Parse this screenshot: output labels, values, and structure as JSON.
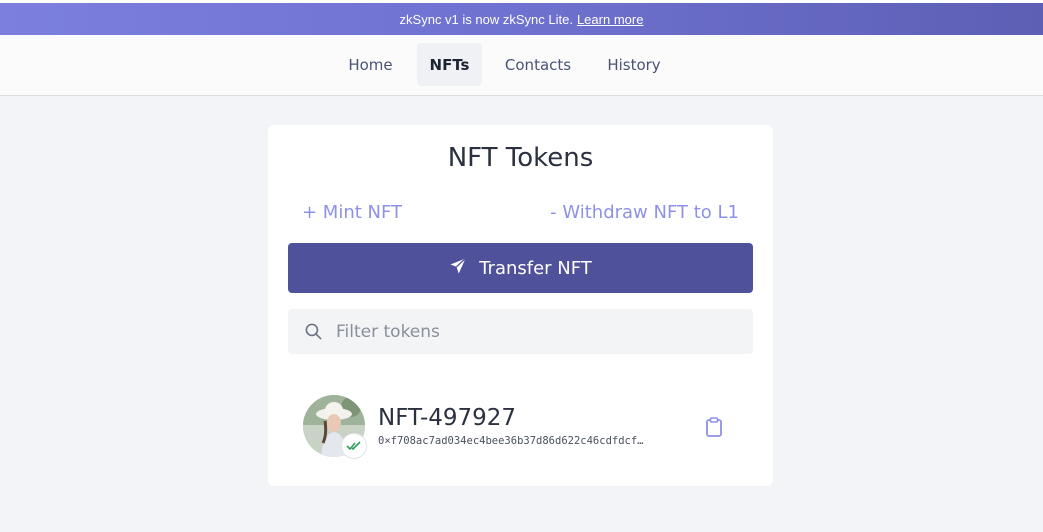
{
  "banner": {
    "text": "zkSync v1 is now zkSync Lite.",
    "link_label": "Learn more"
  },
  "nav": {
    "tabs": [
      {
        "label": "Home",
        "active": false
      },
      {
        "label": "NFTs",
        "active": true
      },
      {
        "label": "Contacts",
        "active": false
      },
      {
        "label": "History",
        "active": false
      }
    ]
  },
  "card": {
    "title": "NFT Tokens",
    "mint_label": "+ Mint NFT",
    "withdraw_label": "- Withdraw NFT to L1",
    "transfer_label": "Transfer NFT",
    "transfer_icon": "send-icon",
    "search": {
      "placeholder": "Filter tokens",
      "value": "",
      "icon": "search-icon"
    },
    "tokens": [
      {
        "name": "NFT-497927",
        "address": "0×f708ac7ad034ec4bee36b37d86d622c46cdfdcf…",
        "verified": true,
        "copy_icon": "clipboard-icon"
      }
    ]
  },
  "colors": {
    "accent": "#4f529b",
    "link": "#8e91e8",
    "banner_start": "#7c7fde",
    "banner_end": "#5d5fb5",
    "verified": "#2e9e5b"
  }
}
